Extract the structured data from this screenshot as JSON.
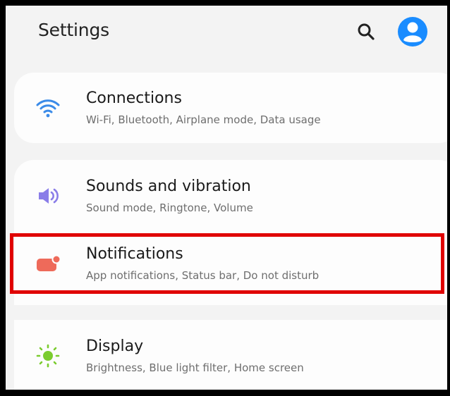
{
  "header": {
    "title": "Settings",
    "search_icon": "search-icon",
    "account_icon": "account-circle-icon"
  },
  "items": [
    {
      "label": "Connections",
      "subtitle": "Wi-Fi, Bluetooth, Airplane mode, Data usage",
      "icon": "wifi-icon",
      "icon_color": "#3b8be8"
    },
    {
      "label": "Sounds and vibration",
      "subtitle": "Sound mode, Ringtone, Volume",
      "icon": "volume-icon",
      "icon_color": "#8a7de8"
    },
    {
      "label": "Notifications",
      "subtitle": "App notifications, Status bar, Do not disturb",
      "icon": "notification-icon",
      "icon_color": "#ee6a5a"
    },
    {
      "label": "Display",
      "subtitle": "Brightness, Blue light filter, Home screen",
      "icon": "brightness-icon",
      "icon_color": "#7bcc2f"
    }
  ],
  "colors": {
    "background": "#f3f3f3",
    "card": "#fdfdfd",
    "accent": "#1a8cff",
    "highlight": "#e00000"
  }
}
